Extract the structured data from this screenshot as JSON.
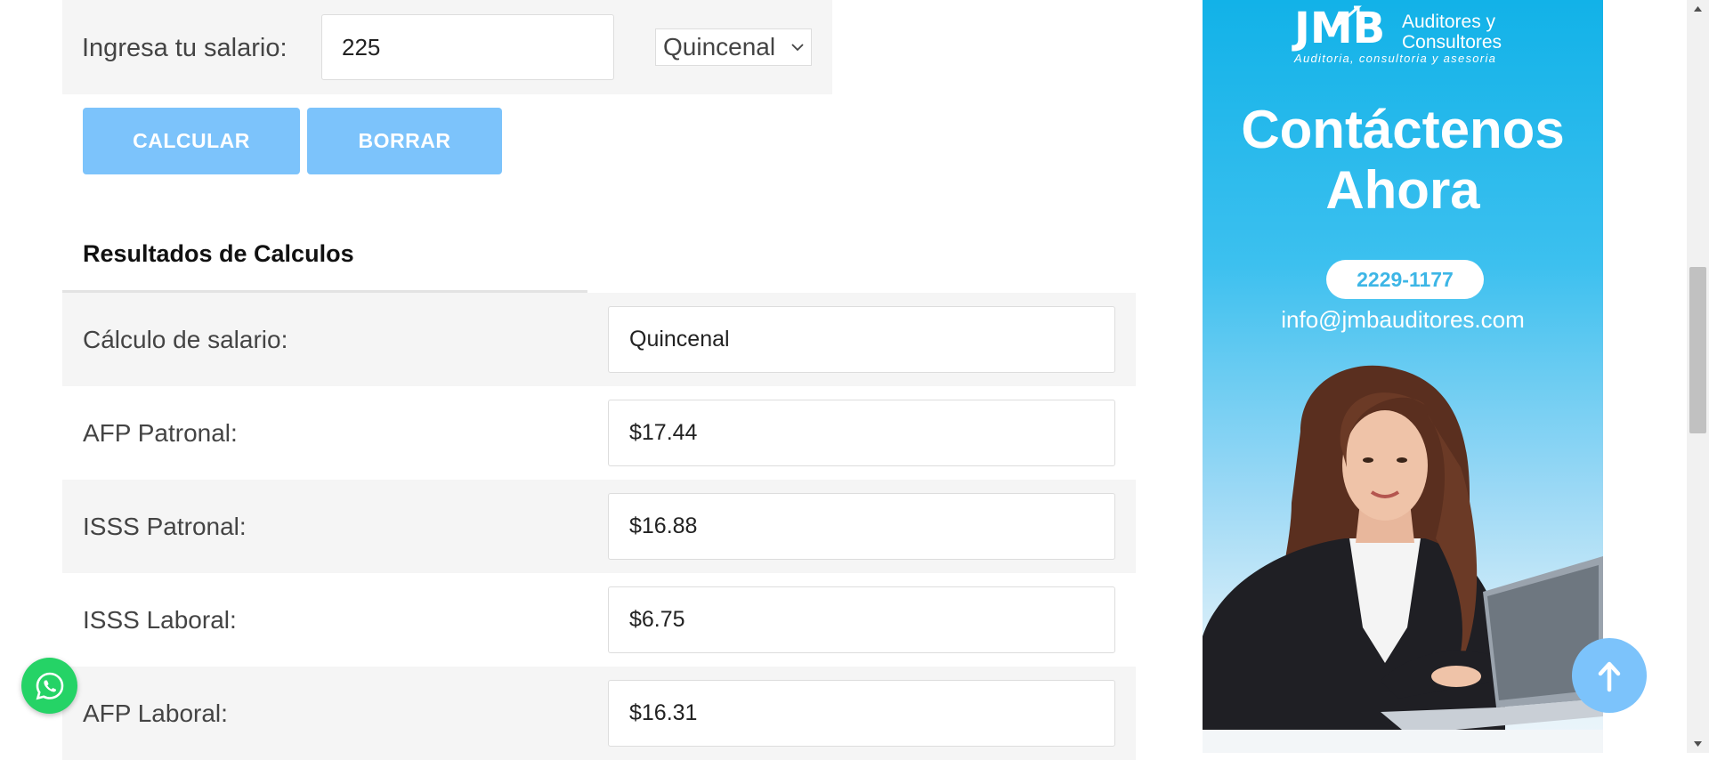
{
  "form": {
    "salary_label": "Ingresa tu salario:",
    "salary_value": "225",
    "period_selected": "Quincenal",
    "calculate_label": "CALCULAR",
    "clear_label": "BORRAR"
  },
  "results": {
    "title": "Resultados de Calculos",
    "rows": [
      {
        "label": "Cálculo de salario:",
        "value": "Quincenal"
      },
      {
        "label": "AFP Patronal:",
        "value": "$17.44"
      },
      {
        "label": "ISSS Patronal:",
        "value": "$16.88"
      },
      {
        "label": "ISSS Laboral:",
        "value": "$6.75"
      },
      {
        "label": "AFP Laboral:",
        "value": "$16.31"
      }
    ]
  },
  "ad": {
    "logo_text": "JMB",
    "logo_name_line1": "Auditores y",
    "logo_name_line2": "Consultores",
    "tagline": "Auditoria, consultoria y asesoria",
    "headline_line1": "Contáctenos",
    "headline_line2": "Ahora",
    "phone": "2229-1177",
    "email": "info@jmbauditores.com"
  },
  "colors": {
    "button": "#7cc3fb",
    "whatsapp": "#25d366",
    "ad_blue": "#12b2e8",
    "row_alt": "#f5f5f5"
  },
  "icons": {
    "whatsapp": "whatsapp-icon",
    "back_to_top": "arrow-up-icon",
    "select": "chevron-down-icon"
  }
}
